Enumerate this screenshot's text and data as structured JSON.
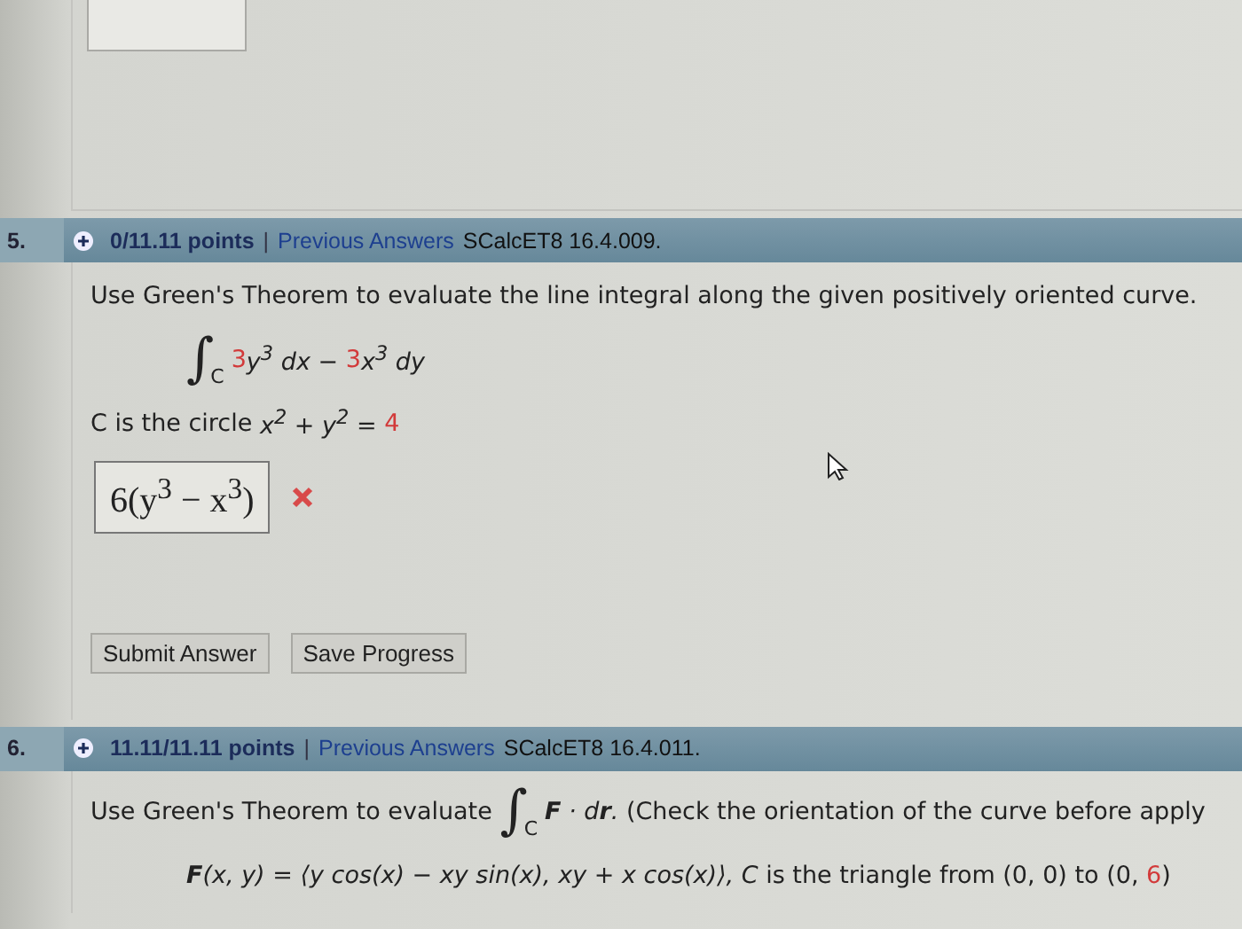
{
  "questions": [
    {
      "number": "5.",
      "points": "0/11.11 points",
      "separator": "|",
      "link": "Previous Answers",
      "source": "SCalcET8 16.4.009.",
      "lines": [
        {
          "indent": false,
          "parts": [
            {
              "kind": "text",
              "text": "Use Green's Theorem to evaluate the line integral along the given positively oriented curve."
            }
          ]
        },
        {
          "indent": true,
          "parts": [
            {
              "kind": "integral",
              "sign": "∫",
              "sub": "C"
            },
            {
              "kind": "given",
              "text": "3"
            },
            {
              "kind": "math",
              "text": "y$^{3}$ dx − "
            },
            {
              "kind": "given",
              "text": "3"
            },
            {
              "kind": "math",
              "text": "x$^{3}$ dy"
            }
          ]
        },
        {
          "indent": false,
          "parts": [
            {
              "kind": "text",
              "text": "C is the circle "
            },
            {
              "kind": "math",
              "text": "x$^{2}$ + y$^{2}$ = "
            },
            {
              "kind": "given",
              "text": "4"
            }
          ]
        }
      ],
      "answer": {
        "value": "6(y$^{3}$ − x$^{3}$)",
        "correct": false
      },
      "buttons": [
        "Submit Answer",
        "Save Progress"
      ]
    },
    {
      "number": "6.",
      "points": "11.11/11.11 points",
      "separator": "|",
      "link": "Previous Answers",
      "source": "SCalcET8 16.4.011.",
      "lines": [
        {
          "indent": false,
          "parts": [
            {
              "kind": "text",
              "text": "Use Green's Theorem to evaluate "
            },
            {
              "kind": "integral",
              "sign": "∫",
              "sub": "C"
            },
            {
              "kind": "math",
              "text": "**F** · d**r**."
            },
            {
              "kind": "text",
              "text": " (Check the orientation of the curve before apply"
            }
          ]
        },
        {
          "indent": true,
          "parts": [
            {
              "kind": "math",
              "text": "**F**(x, y) = ⟨y cos(x) − xy sin(x), xy + x cos(x)⟩, "
            },
            {
              "kind": "math",
              "text": "*C*"
            },
            {
              "kind": "text",
              "text": " is the triangle from (0, 0) to (0, "
            },
            {
              "kind": "given",
              "text": "6"
            },
            {
              "kind": "text",
              "text": ")"
            }
          ]
        }
      ]
    }
  ]
}
